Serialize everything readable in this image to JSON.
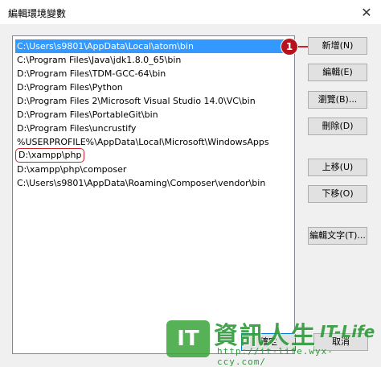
{
  "window": {
    "title": "編輯環境變數",
    "close_symbol": "✕"
  },
  "paths": [
    "C:\\Users\\s9801\\AppData\\Local\\atom\\bin",
    "C:\\Program Files\\Java\\jdk1.8.0_65\\bin",
    "D:\\Program Files\\TDM-GCC-64\\bin",
    "D:\\Program Files\\Python",
    "D:\\Program Files 2\\Microsoft Visual Studio 14.0\\VC\\bin",
    "D:\\Program Files\\PortableGit\\bin",
    "D:\\Program Files\\uncrustify",
    "%USERPROFILE%\\AppData\\Local\\Microsoft\\WindowsApps",
    "D:\\xampp\\php",
    "D:\\xampp\\php\\composer",
    "C:\\Users\\s9801\\AppData\\Roaming\\Composer\\vendor\\bin"
  ],
  "selected_index": 0,
  "highlighted_index": 8,
  "buttons": {
    "new": "新增(N)",
    "edit": "編輯(E)",
    "browse": "瀏覽(B)...",
    "delete": "刪除(D)",
    "move_up": "上移(U)",
    "move_down": "下移(O)",
    "edit_text": "編輯文字(T)...",
    "ok": "確定",
    "cancel": "取消"
  },
  "annotation": {
    "step": "1"
  },
  "watermark": {
    "logo": "IT",
    "name": "資訊人生",
    "brand": "IT-Life",
    "url": "http://it-life.wyx-ccy.com/"
  },
  "colors": {
    "selection": "#3399ff",
    "annotation": "#d0202a",
    "watermark": "#2f9a3a"
  }
}
